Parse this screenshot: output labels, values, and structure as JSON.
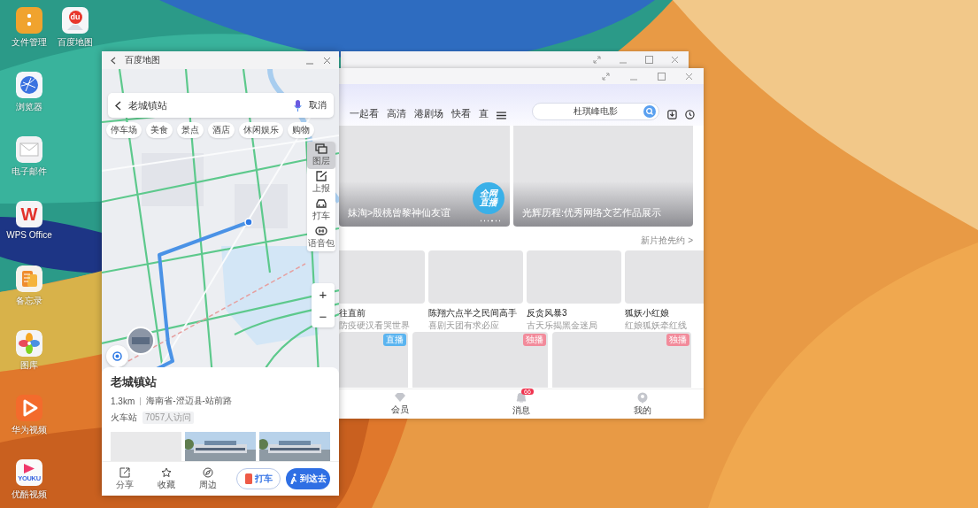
{
  "desktop": {
    "icon_columns": [
      {
        "icons": [
          {
            "label": "文件管理",
            "kind": "files"
          },
          {
            "label": "浏览器",
            "kind": "browser"
          },
          {
            "label": "电子邮件",
            "kind": "mail"
          },
          {
            "label": "WPS Office",
            "kind": "wps",
            "glyph": "W"
          },
          {
            "label": "备忘录",
            "kind": "notes"
          },
          {
            "label": "图库",
            "kind": "gallery"
          },
          {
            "label": "华为视频",
            "kind": "video"
          },
          {
            "label": "优酷视频",
            "kind": "youku",
            "glyph": "YOUKU"
          }
        ]
      },
      {
        "icons": [
          {
            "label": "百度地图",
            "kind": "baidu",
            "glyph": "du"
          }
        ]
      }
    ]
  },
  "video_window": {
    "nav_tabs": [
      {
        "label": "一起看"
      },
      {
        "label": "高清"
      },
      {
        "label": "港剧场"
      },
      {
        "label": "快看"
      },
      {
        "label": "直"
      }
    ],
    "search": {
      "value": "杜琪峰电影"
    },
    "banners": [
      {
        "title": "妹淘>殷桃曾黎神仙友谊",
        "badge": "全网直播"
      },
      {
        "title": "光辉历程:优秀网络文艺作品展示"
      }
    ],
    "promo_link": "新片抢先约 >",
    "shows": [
      {
        "title": "往直前",
        "subtitle": "防疫硬汉看哭世界"
      },
      {
        "title": "陈翔六点半之民间高手",
        "subtitle": "喜剧天团有求必应"
      },
      {
        "title": "反贪风暴3",
        "subtitle": "古天乐揭黑金迷局"
      },
      {
        "title": "狐妖小红娘",
        "subtitle": "红娘狐妖牵红线"
      }
    ],
    "tiles": [
      {
        "tag": "直播",
        "color": "#5ab4f0"
      },
      {
        "tag": "独播",
        "color": "#f28b9b"
      },
      {
        "tag": "独播",
        "color": "#f28b9b"
      }
    ],
    "bottom_nav": [
      {
        "label": "会员",
        "kind": "vip"
      },
      {
        "label": "消息",
        "kind": "message",
        "badge": "66"
      },
      {
        "label": "我的",
        "kind": "profile"
      }
    ]
  },
  "map_window": {
    "title": "百度地图",
    "search": {
      "value": "老城镇站",
      "cancel": "取消"
    },
    "chips": [
      "停车场",
      "美食",
      "景点",
      "酒店",
      "休闲娱乐",
      "购物"
    ],
    "tools": [
      {
        "label": "图层",
        "kind": "layers",
        "selected": true
      },
      {
        "label": "上报",
        "kind": "report",
        "selected": false
      },
      {
        "label": "打车",
        "kind": "taxi",
        "selected": false
      },
      {
        "label": "语音包",
        "kind": "voice",
        "selected": false
      }
    ],
    "zoom": [
      "+",
      "−"
    ],
    "place": {
      "name": "老城镇站",
      "distance": "1.3km",
      "address": "海南省-澄迈县-站前路",
      "category": "火车站",
      "visits": "7057人访问"
    },
    "photos": [
      {
        "kind": "blank"
      },
      {
        "kind": "picture"
      },
      {
        "kind": "picture"
      }
    ],
    "actions": [
      {
        "label": "分享",
        "kind": "share"
      },
      {
        "label": "收藏",
        "kind": "star"
      },
      {
        "label": "周边",
        "kind": "compass"
      }
    ],
    "buttons": [
      {
        "label": "打车",
        "kind": "outline"
      },
      {
        "label": "到这去",
        "kind": "primary"
      }
    ]
  }
}
